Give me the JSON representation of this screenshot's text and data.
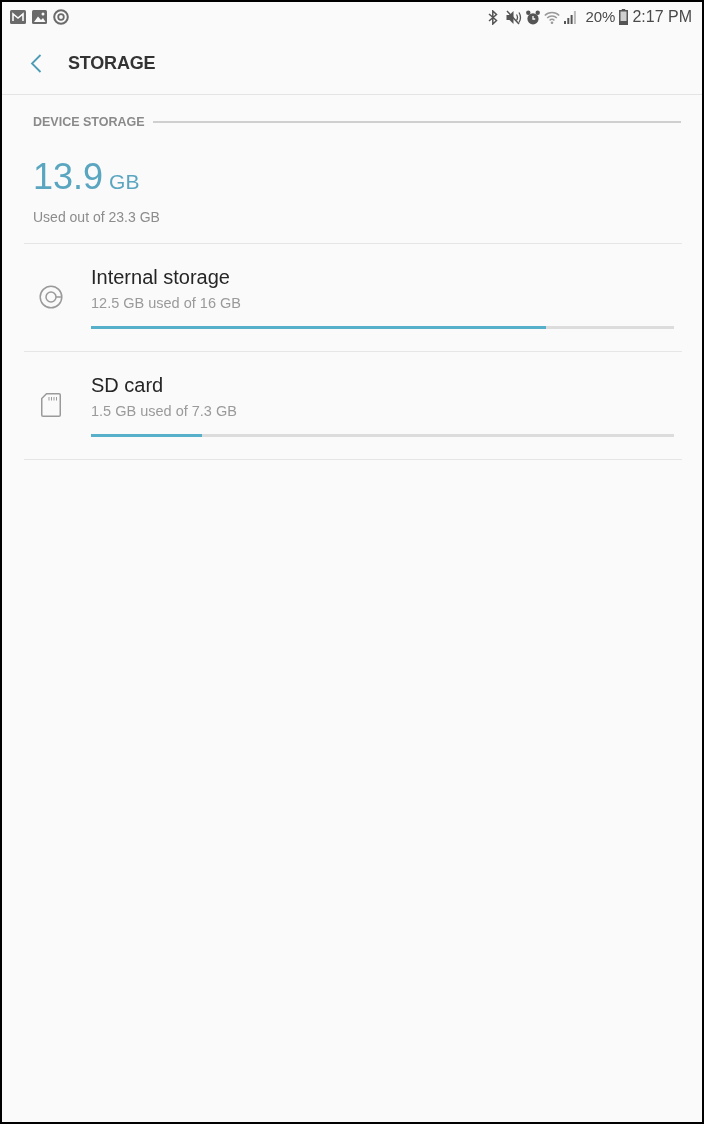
{
  "status_bar": {
    "battery_text": "20%",
    "time": "2:17 PM"
  },
  "app_bar": {
    "title": "STORAGE"
  },
  "device_storage": {
    "header": "DEVICE STORAGE",
    "used_value": "13.9",
    "used_unit": "GB",
    "caption": "Used out of 23.3 GB"
  },
  "storage_items": [
    {
      "kind": "internal",
      "title": "Internal storage",
      "usage": "12.5 GB used of 16 GB",
      "level": 0.78
    },
    {
      "kind": "sd_card",
      "title": "SD card",
      "usage": "1.5 GB used of 7.3 GB",
      "level": 0.19
    }
  ]
}
